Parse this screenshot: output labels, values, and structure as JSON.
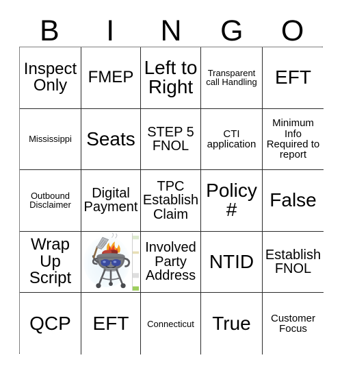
{
  "card": {
    "title_letters": [
      "B",
      "I",
      "N",
      "G",
      "O"
    ],
    "columns": 5,
    "rows": 5,
    "border_color": "#2b2b2b",
    "background": "#ffffff",
    "text_color": "#000000",
    "cells": [
      [
        {
          "text": "Inspect Only",
          "size": "lg"
        },
        {
          "text": "FMEP",
          "size": "lg"
        },
        {
          "text": "Left to Right",
          "size": "xl"
        },
        {
          "text": "Transparent call Handling",
          "size": "xs"
        },
        {
          "text": "EFT",
          "size": "xl"
        }
      ],
      [
        {
          "text": "Mississippi",
          "size": "xs"
        },
        {
          "text": "Seats",
          "size": "xl"
        },
        {
          "text": "STEP 5 FNOL",
          "size": "md"
        },
        {
          "text": "CTI application",
          "size": "sm"
        },
        {
          "text": "Minimum Info Required to report",
          "size": "sm"
        }
      ],
      [
        {
          "text": "Outbound Disclaimer",
          "size": "xs"
        },
        {
          "text": "Digital Payment",
          "size": "md"
        },
        {
          "text": "TPC Establish Claim",
          "size": "md"
        },
        {
          "text": "Policy #",
          "size": "xl"
        },
        {
          "text": "False",
          "size": "xl"
        }
      ],
      [
        {
          "text": "Wrap Up Script",
          "size": "lg"
        },
        {
          "type": "image",
          "alt": "cartoon barbecue grill mascot with sunglasses holding a spatula, flames and steak on the grill"
        },
        {
          "text": "Involved Party Address",
          "size": "md"
        },
        {
          "text": "NTID",
          "size": "xl"
        },
        {
          "text": "Establish FNOL",
          "size": "md"
        }
      ],
      [
        {
          "text": "QCP",
          "size": "xl"
        },
        {
          "text": "EFT",
          "size": "xl"
        },
        {
          "text": "Connecticut",
          "size": "xs"
        },
        {
          "text": "True",
          "size": "xl"
        },
        {
          "text": "Customer Focus",
          "size": "sm"
        }
      ]
    ]
  },
  "image_colors": {
    "grill_body": "#6e6f73",
    "grill_dark": "#4a4b4f",
    "sunglasses": "#3a4a9e",
    "flame_outer": "#f5a623",
    "flame_inner": "#e8442a",
    "meat": "#a8352c",
    "spatula": "#b9bcc2",
    "halo": "#eaf4fb"
  }
}
